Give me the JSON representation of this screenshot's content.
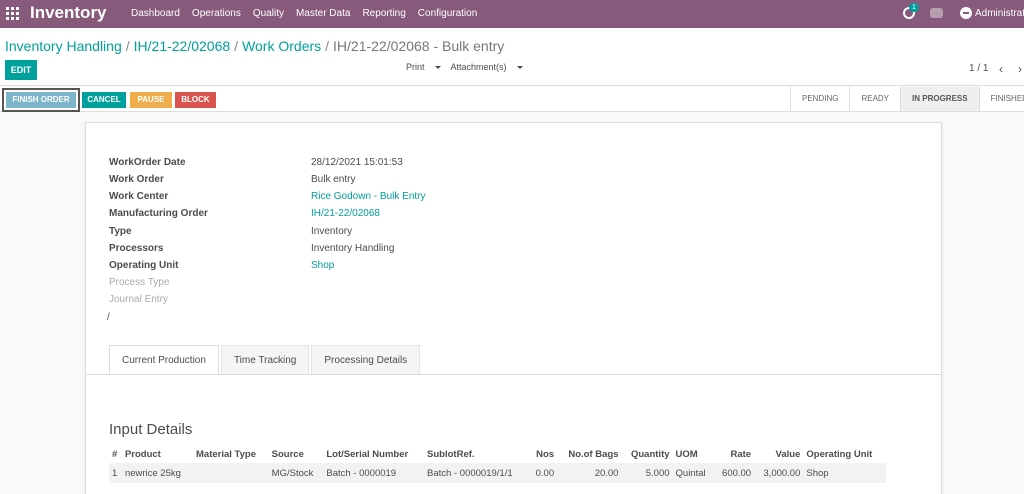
{
  "navbar": {
    "app_title": "Inventory",
    "menu": [
      "Dashboard",
      "Operations",
      "Quality",
      "Master Data",
      "Reporting",
      "Configuration"
    ],
    "activity_badge": "1",
    "user": "Administrator"
  },
  "breadcrumb": {
    "items": [
      "Inventory Handling",
      "IH/21-22/02068",
      "Work Orders"
    ],
    "separator": "/",
    "current": "IH/21-22/02068 - Bulk entry"
  },
  "toolbar": {
    "edit_label": "EDIT",
    "print_label": "Print",
    "attachments_label": "Attachment(s)",
    "pager": "1 / 1",
    "prev_icon": "‹",
    "next_icon": "›"
  },
  "statusbar": {
    "buttons": {
      "finish": "FINISH ORDER",
      "cancel": "CANCEL",
      "pause": "PAUSE",
      "block": "BLOCK"
    },
    "stages": [
      "PENDING",
      "READY",
      "IN PROGRESS",
      "FINISHED"
    ],
    "active_stage": "IN PROGRESS"
  },
  "form": {
    "fields": [
      {
        "label": "WorkOrder Date",
        "value": "28/12/2021 15:01:53"
      },
      {
        "label": "Work Order",
        "value": "Bulk entry"
      },
      {
        "label": "Work Center",
        "value": "Rice Godown - Bulk Entry"
      },
      {
        "label": "Manufacturing Order",
        "value": "IH/21-22/02068"
      },
      {
        "label": "Type",
        "value": "Inventory"
      },
      {
        "label": "Processors",
        "value": "Inventory Handling"
      },
      {
        "label": "Operating Unit",
        "value": "Shop"
      },
      {
        "label": "Process Type",
        "value": ""
      },
      {
        "label": "Journal Entry",
        "value": ""
      }
    ],
    "slash": "/"
  },
  "tabs": [
    "Current Production",
    "Time Tracking",
    "Processing Details"
  ],
  "input_details": {
    "title": "Input Details",
    "columns": [
      "#",
      "Product",
      "Material Type",
      "Source",
      "Lot/Serial Number",
      "SublotRef.",
      "Nos",
      "No.of Bags",
      "Quantity",
      "UOM",
      "Rate",
      "Value",
      "Operating Unit"
    ],
    "row": {
      "index": "1",
      "product": "newrice 25kg",
      "material_type": "",
      "source": "MG/Stock",
      "lot": "Batch - 0000019",
      "sublot": "Batch - 0000019/1/1",
      "nos": "0.00",
      "bags": "20.00",
      "quantity": "5.000",
      "uom": "Quintal",
      "rate": "600.00",
      "value": "3,000.00",
      "unit": "Shop"
    }
  },
  "colors": {
    "brand": "#875a7b",
    "accent": "#00a09d",
    "pause": "#f0ad4e",
    "block": "#d9534f",
    "finish": "#7cb4cc"
  }
}
